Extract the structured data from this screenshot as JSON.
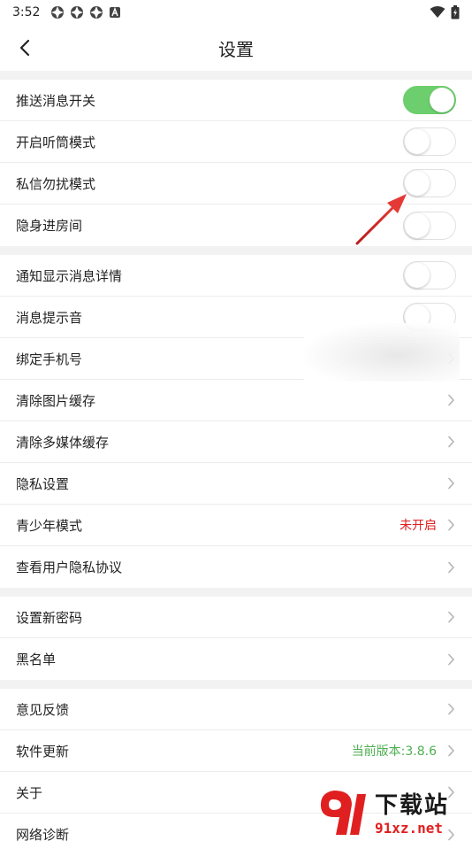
{
  "status_bar": {
    "time": "3:52"
  },
  "header": {
    "title": "设置"
  },
  "colors": {
    "toggle_on": "#6cce6c",
    "value_red": "#e02020",
    "value_green": "#4caf50",
    "arrow": "#d32f2f"
  },
  "groups": [
    {
      "items": [
        {
          "label": "推送消息开关",
          "toggle": true
        },
        {
          "label": "开启听筒模式",
          "toggle": false
        },
        {
          "label": "私信勿扰模式",
          "toggle": false
        },
        {
          "label": "隐身进房间",
          "toggle": false
        }
      ]
    },
    {
      "items": [
        {
          "label": "通知显示消息详情",
          "toggle": false
        },
        {
          "label": "消息提示音",
          "toggle": false
        },
        {
          "label": "绑定手机号"
        },
        {
          "label": "清除图片缓存"
        },
        {
          "label": "清除多媒体缓存"
        },
        {
          "label": "隐私设置"
        },
        {
          "label": "青少年模式",
          "value": "未开启"
        },
        {
          "label": "查看用户隐私协议"
        }
      ]
    },
    {
      "items": [
        {
          "label": "设置新密码"
        },
        {
          "label": "黑名单"
        }
      ]
    },
    {
      "items": [
        {
          "label": "意见反馈"
        },
        {
          "label": "软件更新",
          "value": "当前版本:3.8.6"
        },
        {
          "label": "关于"
        },
        {
          "label": "网络诊断"
        }
      ]
    }
  ],
  "watermark": {
    "brand": "下载站",
    "site": "91xz.net"
  }
}
